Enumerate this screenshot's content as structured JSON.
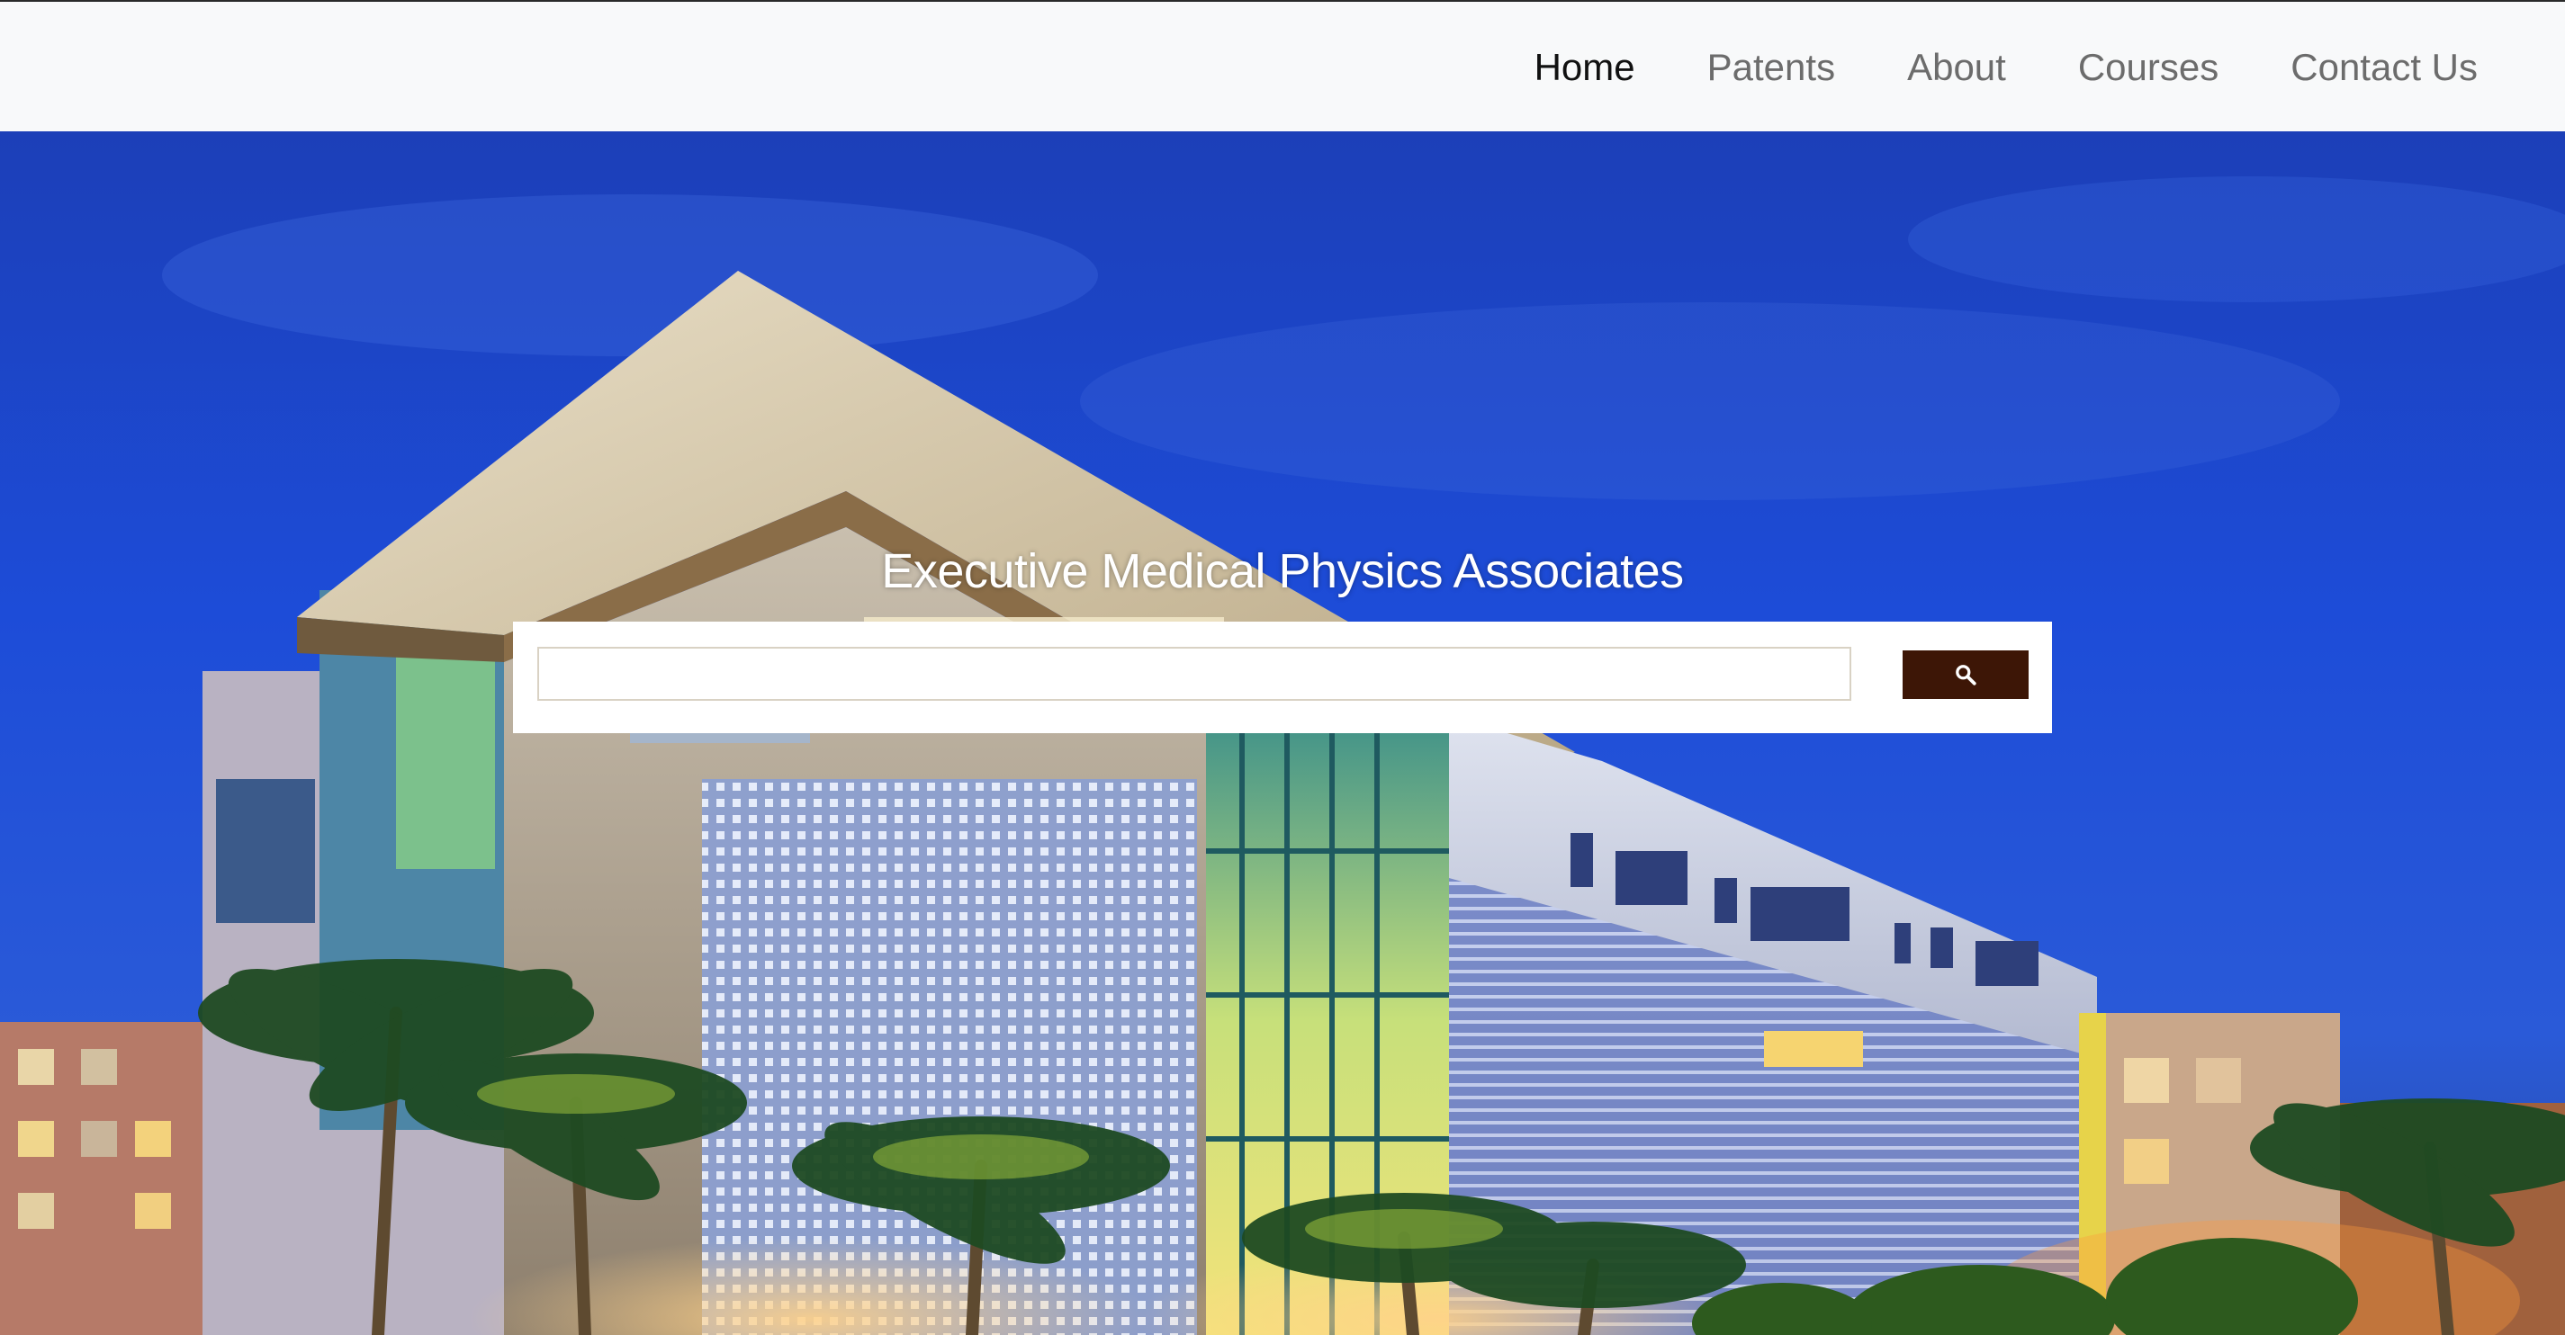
{
  "nav": {
    "items": [
      {
        "label": "Home",
        "active": true
      },
      {
        "label": "Patents",
        "active": false
      },
      {
        "label": "About",
        "active": false
      },
      {
        "label": "Courses",
        "active": false
      },
      {
        "label": "Contact Us",
        "active": false
      }
    ]
  },
  "hero": {
    "title": "Executive Medical Physics Associates",
    "background": "photo of modern lit building with palm trees at dusk under blue sky"
  },
  "search": {
    "input_value": "",
    "button_icon": "search-icon"
  },
  "colors": {
    "navbar_bg": "#f8f9fa",
    "nav_active": "#111111",
    "nav_inactive": "#6c6c6c",
    "search_button": "#3d1606",
    "sky": "#1b4ad6"
  }
}
